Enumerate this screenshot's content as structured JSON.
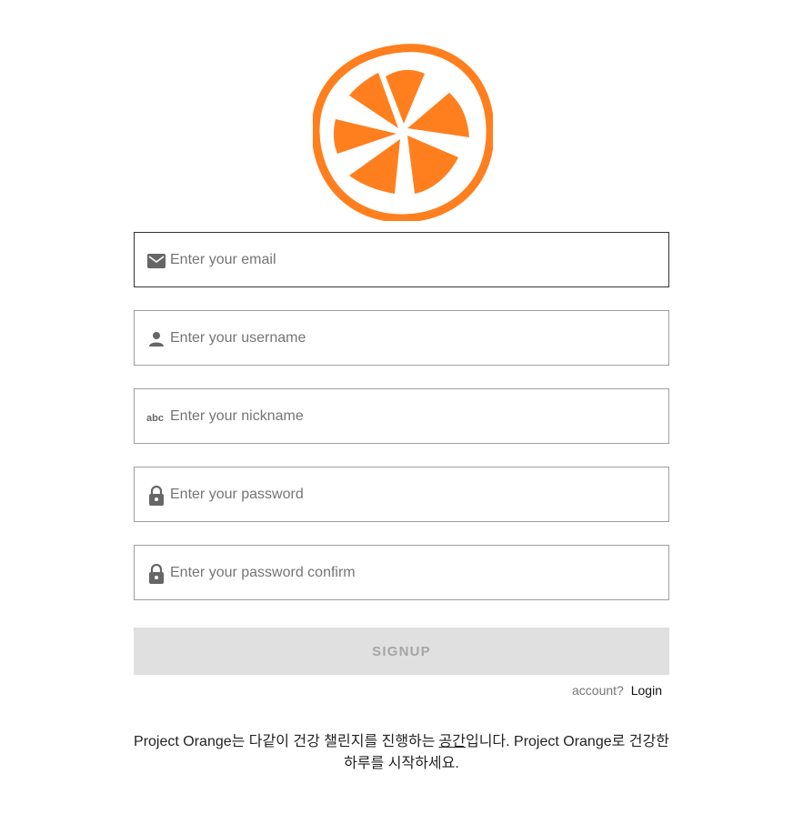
{
  "logo": {
    "icon": "orange-slice-logo",
    "color": "#FF7F1E"
  },
  "form": {
    "email": {
      "placeholder": "Enter your email",
      "icon": "mail-icon"
    },
    "username": {
      "placeholder": "Enter your username",
      "icon": "person-icon"
    },
    "nickname": {
      "placeholder": "Enter your nickname",
      "icon": "abc-icon"
    },
    "password": {
      "placeholder": "Enter your password",
      "icon": "lock-icon"
    },
    "password_confirm": {
      "placeholder": "Enter your password confirm",
      "icon": "lock-icon"
    }
  },
  "signup": {
    "label": "SIGNUP"
  },
  "account": {
    "question": "account?",
    "login_label": "Login"
  },
  "description": {
    "part1": "Project Orange는 다같이 건강 챌린지를 진행하는",
    "underlined": "공간",
    "part2": "입니다. Project Orange로 건강한 하루를 시작하세요."
  }
}
